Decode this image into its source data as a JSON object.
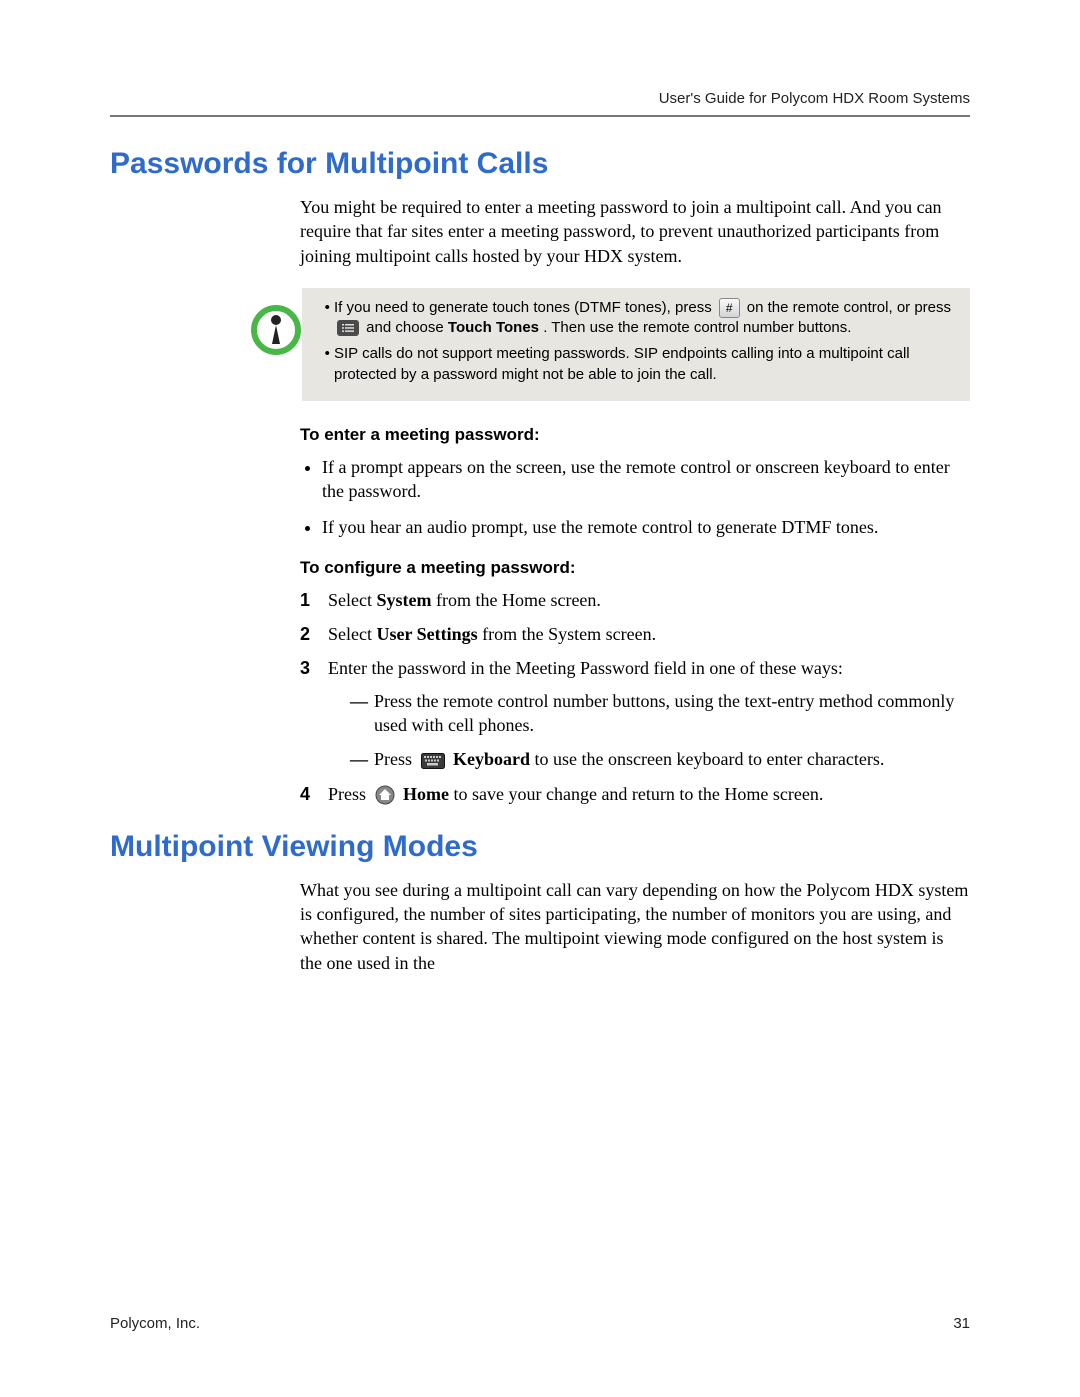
{
  "header": "User's Guide for Polycom HDX Room Systems",
  "section1": {
    "title": "Passwords for Multipoint Calls",
    "intro": "You might be required to enter a meeting password to join a multipoint call. And you can require that far sites enter a meeting password, to prevent unauthorized participants from joining multipoint calls hosted by your HDX system.",
    "note": {
      "item1": {
        "part1": "If you need to generate touch tones (DTMF tones), press ",
        "hash": "#",
        "part2": " on the remote control, or press ",
        "part3": " and choose ",
        "bold1": "Touch Tones",
        "part4": ". Then use the remote control number buttons."
      },
      "item2": "SIP calls do not support meeting passwords. SIP endpoints calling into a multipoint call protected by a password might not be able to join the call."
    },
    "enterHeading": "To enter a meeting password:",
    "enterBullets": [
      "If a prompt appears on the screen, use the remote control  or onscreen keyboard to enter the password.",
      "If you hear an audio prompt, use the remote control to generate DTMF tones."
    ],
    "configHeading": "To configure a meeting password:",
    "steps": {
      "s1": {
        "pre": "Select ",
        "b": "System",
        "post": " from the Home screen."
      },
      "s2": {
        "pre": "Select ",
        "b": "User Settings",
        "post": " from the System screen."
      },
      "s3": {
        "text": "Enter the password in the Meeting Password field in one of these ways:",
        "d1": "Press the remote control number buttons, using the text-entry method commonly used with cell phones.",
        "d2pre": "Press ",
        "d2b": "Keyboard",
        "d2post": " to use the onscreen keyboard to enter characters."
      },
      "s4": {
        "pre": "Press ",
        "b": "Home",
        "post": " to save your change and return to the Home screen."
      }
    }
  },
  "section2": {
    "title": "Multipoint Viewing Modes",
    "intro": "What you see during a multipoint call can vary depending on how the Polycom HDX system is configured, the number of sites participating, the number of monitors you are using, and whether content is shared. The multipoint viewing mode configured on the host system is the one used in the"
  },
  "footer": {
    "left": "Polycom, Inc.",
    "right": "31"
  }
}
